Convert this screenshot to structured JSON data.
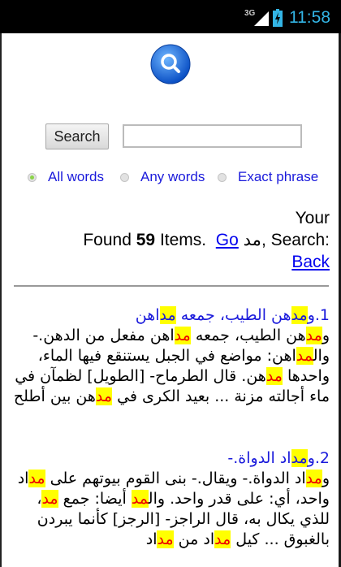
{
  "status": {
    "network": "3G",
    "time": "11:58"
  },
  "search": {
    "button_label": "Search",
    "input_value": "",
    "input_placeholder": ""
  },
  "options": [
    {
      "label": "All words",
      "selected": true
    },
    {
      "label": "Any words",
      "selected": false
    },
    {
      "label": "Exact phrase",
      "selected": false
    }
  ],
  "results_header": {
    "your_label": "Your",
    "search_label": "Search:",
    "query": "مد",
    "found_prefix": "Found",
    "count": "59",
    "found_suffix": "Items.",
    "go_label": "Go",
    "back_label": "Back"
  },
  "results": [
    {
      "title_parts": [
        "1.و",
        "مد",
        "هن الطيب، جمعه ",
        "مد",
        "اهن"
      ],
      "body_parts": [
        "و",
        "مد",
        "هن الطيب، جمعه ",
        "مد",
        "اهن مفعل من الدهن.- وال",
        "مد",
        "اهن: مواضع في الجبل يستنقع فيها الماء، واحدها ",
        "مد",
        "هن. قال الطرماح- [الطويل] لظمآن في ماء أجالته مزنة ... بعيد الكرى في ",
        "مد",
        "هن بين أطلح"
      ]
    },
    {
      "title_parts": [
        "2.و",
        "مد",
        "اد الدواة.-"
      ],
      "body_parts": [
        "و",
        "مد",
        "اد الدواة.- ويقال.- بنى القوم بيوتهم على ",
        "مد",
        "اد واحد، أي: على قدر واحد. وال",
        "مد",
        " أيضا: جمع ",
        "مد",
        "، للذي يكال به، قال الراجز- [الرجز] كأنما يبردن بالغبوق ... كيل ",
        "مد",
        "اد من ",
        "مد",
        "اد "
      ]
    }
  ]
}
